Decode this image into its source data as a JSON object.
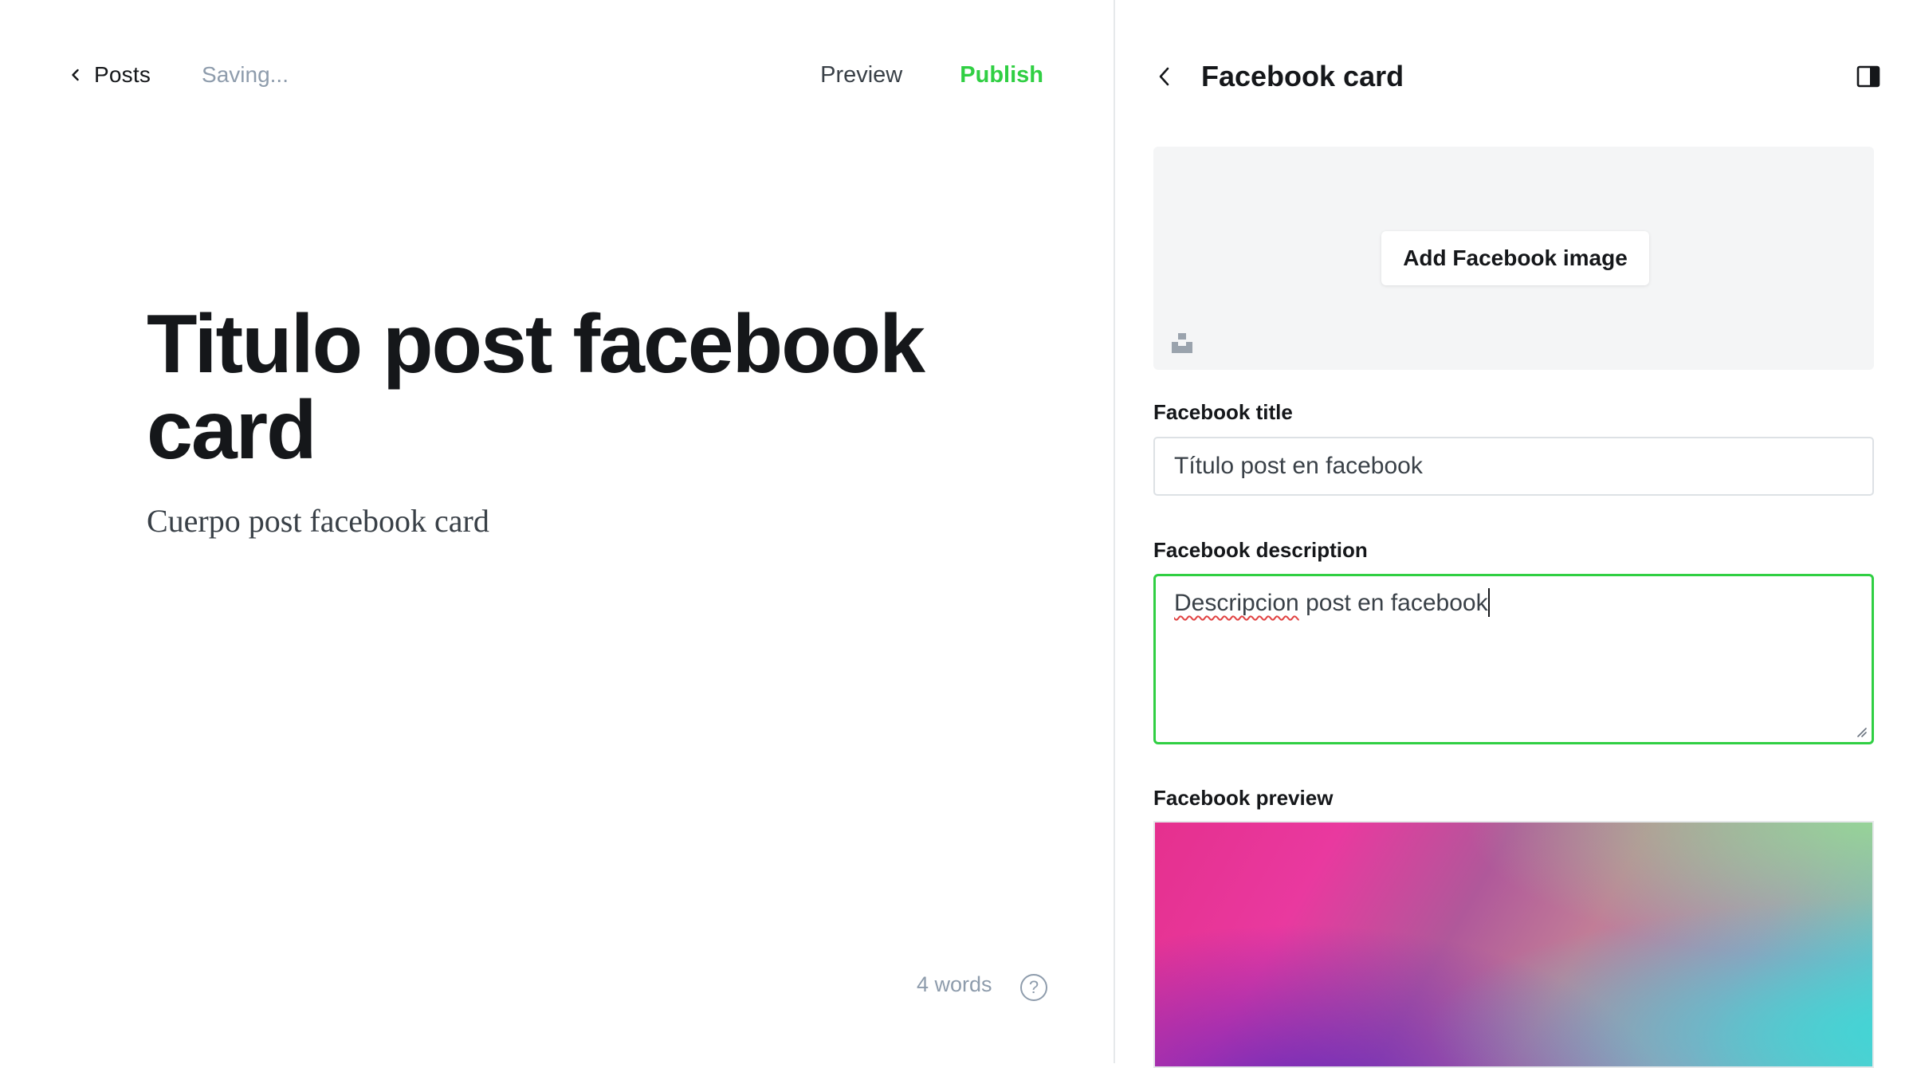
{
  "editor": {
    "back_label": "Posts",
    "status": "Saving...",
    "preview_label": "Preview",
    "publish_label": "Publish",
    "title": "Titulo post facebook card",
    "body": "Cuerpo post facebook card",
    "word_count": "4 words",
    "help_glyph": "?"
  },
  "panel": {
    "title": "Facebook card",
    "add_image_label": "Add Facebook image",
    "title_field": {
      "label": "Facebook title",
      "value": "Título post en facebook"
    },
    "description_field": {
      "label": "Facebook description",
      "value_misspelled": "Descripcion",
      "value_rest": " post en facebook"
    },
    "preview_label": "Facebook preview"
  },
  "colors": {
    "accent": "#30cf43",
    "muted": "#8e9cac",
    "text": "#15171a"
  },
  "icons": [
    "chevron-left-icon",
    "sidebar-toggle-icon",
    "unsplash-icon",
    "help-icon"
  ]
}
